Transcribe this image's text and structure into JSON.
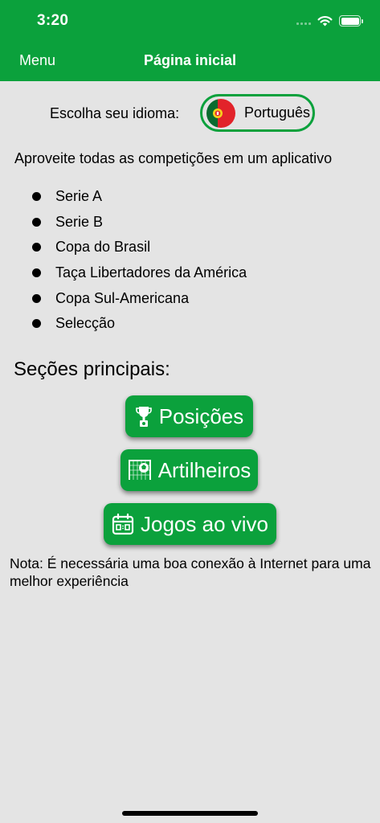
{
  "status_bar": {
    "time": "3:20"
  },
  "nav": {
    "menu_label": "Menu",
    "title": "Página inicial"
  },
  "language": {
    "prompt": "Escolha seu idioma:",
    "selected": "Português",
    "flag_icon": "portugal-flag-icon"
  },
  "intro": "Aproveite todas as competições em um aplicativo",
  "competitions": [
    "Serie A",
    "Serie B",
    "Copa do Brasil",
    "Taça Libertadores da América",
    "Copa Sul-Americana",
    "Selecção"
  ],
  "sections": {
    "title": "Seções principais:",
    "buttons": [
      {
        "label": "Posições",
        "icon": "trophy-icon"
      },
      {
        "label": "Artilheiros",
        "icon": "goal-net-icon"
      },
      {
        "label": "Jogos ao vivo",
        "icon": "calendar-icon"
      }
    ]
  },
  "note": "Nota: É necessária uma boa conexão à Internet para uma melhor experiência",
  "colors": {
    "primary": "#0ba13c",
    "background": "#e4e4e4"
  }
}
